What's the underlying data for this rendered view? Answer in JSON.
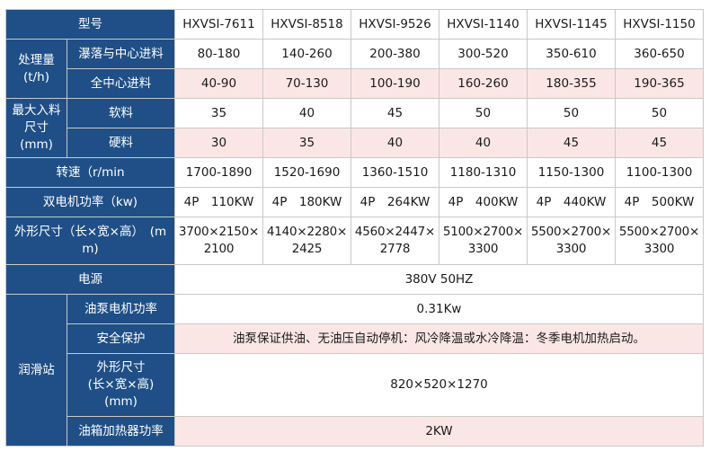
{
  "table": {
    "model_label": "型号",
    "models": [
      "HXVSI-7611",
      "HXVSI-8518",
      "HXVSI-9526",
      "HXVSI-1140",
      "HXVSI-1145",
      "HXVSI-1150"
    ],
    "capacity": {
      "label": "处理量\n(t/h)",
      "rows": [
        {
          "label": "瀑落与中心进料",
          "values": [
            "80-180",
            "140-260",
            "200-380",
            "300-520",
            "350-610",
            "360-650"
          ]
        },
        {
          "label": "全中心进料",
          "values": [
            "40-90",
            "70-130",
            "100-190",
            "160-260",
            "180-355",
            "190-365"
          ]
        }
      ]
    },
    "max_feed": {
      "label": "最大入料\n尺寸\n(mm)",
      "rows": [
        {
          "label": "软料",
          "values": [
            "35",
            "40",
            "45",
            "50",
            "50",
            "50"
          ]
        },
        {
          "label": "硬料",
          "values": [
            "30",
            "35",
            "40",
            "40",
            "45",
            "45"
          ]
        }
      ]
    },
    "speed": {
      "label": "转速（r/min",
      "values": [
        "1700-1890",
        "1520-1690",
        "1360-1510",
        "1180-1310",
        "1150-1300",
        "1100-1300"
      ]
    },
    "motor_power": {
      "label": "双电机功率（kw)",
      "values": [
        "4P　110KW",
        "4P　180KW",
        "4P　264KW",
        "4P　400KW",
        "4P　440KW",
        "4P　500KW"
      ]
    },
    "dimensions": {
      "label": "外形尺寸（长×宽×高）　(mm)",
      "values": [
        "3700×2150×2100",
        "4140×2280×2425",
        "4560×2447×2778",
        "5100×2700×3300",
        "5500×2700×3300",
        "5500×2700×3300"
      ]
    },
    "power_supply": {
      "label": "电源",
      "value": "380V 50HZ"
    },
    "lubrication": {
      "label": "润滑站",
      "rows": [
        {
          "label": "油泵电机功率",
          "value": "0.31Kw"
        },
        {
          "label": "安全保护",
          "value": "油泵保证供油、无油压自动停机：风冷降温或水冷降温：冬季电机加热启动。"
        },
        {
          "label": "外形尺寸\n(长×宽×高)\n(mm)",
          "value": "820×520×1270"
        },
        {
          "label": "油箱加热器功率",
          "value": "2KW"
        }
      ]
    }
  }
}
